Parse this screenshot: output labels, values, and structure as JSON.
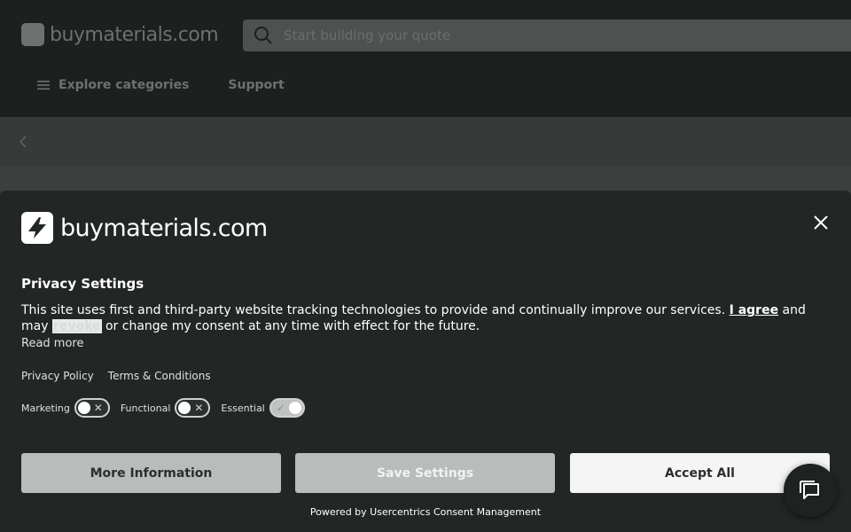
{
  "header": {
    "logo_text": "buymaterials.com",
    "search_placeholder": "Start building your quote",
    "nav": [
      {
        "label": "Explore categories",
        "icon": "menu-icon"
      },
      {
        "label": "Support"
      }
    ]
  },
  "consent": {
    "logo_text": "buymaterials.com",
    "title": "Privacy Settings",
    "description_part1": "This site uses first and third-party website tracking technologies to provide and continually improve our services. ",
    "agree_link": "I agree",
    "description_part2": " and may ",
    "revoke_link": "revoke",
    "description_part3": " or change my consent at any time with effect for the future.",
    "read_more": "Read more",
    "links": {
      "privacy_policy": "Privacy Policy",
      "terms": "Terms & Conditions"
    },
    "toggles": [
      {
        "label": "Marketing",
        "on": false
      },
      {
        "label": "Functional",
        "on": false
      },
      {
        "label": "Essential",
        "on": true
      }
    ],
    "buttons": {
      "more_info": "More Information",
      "save": "Save Settings",
      "accept": "Accept All"
    },
    "powered_by": "Powered by Usercentrics Consent Management"
  },
  "colors": {
    "modal_bg": "#222624",
    "header_bg": "#1c201f",
    "button_grey": "#b9bcbb",
    "accept_bg": "#f5f5f5"
  }
}
